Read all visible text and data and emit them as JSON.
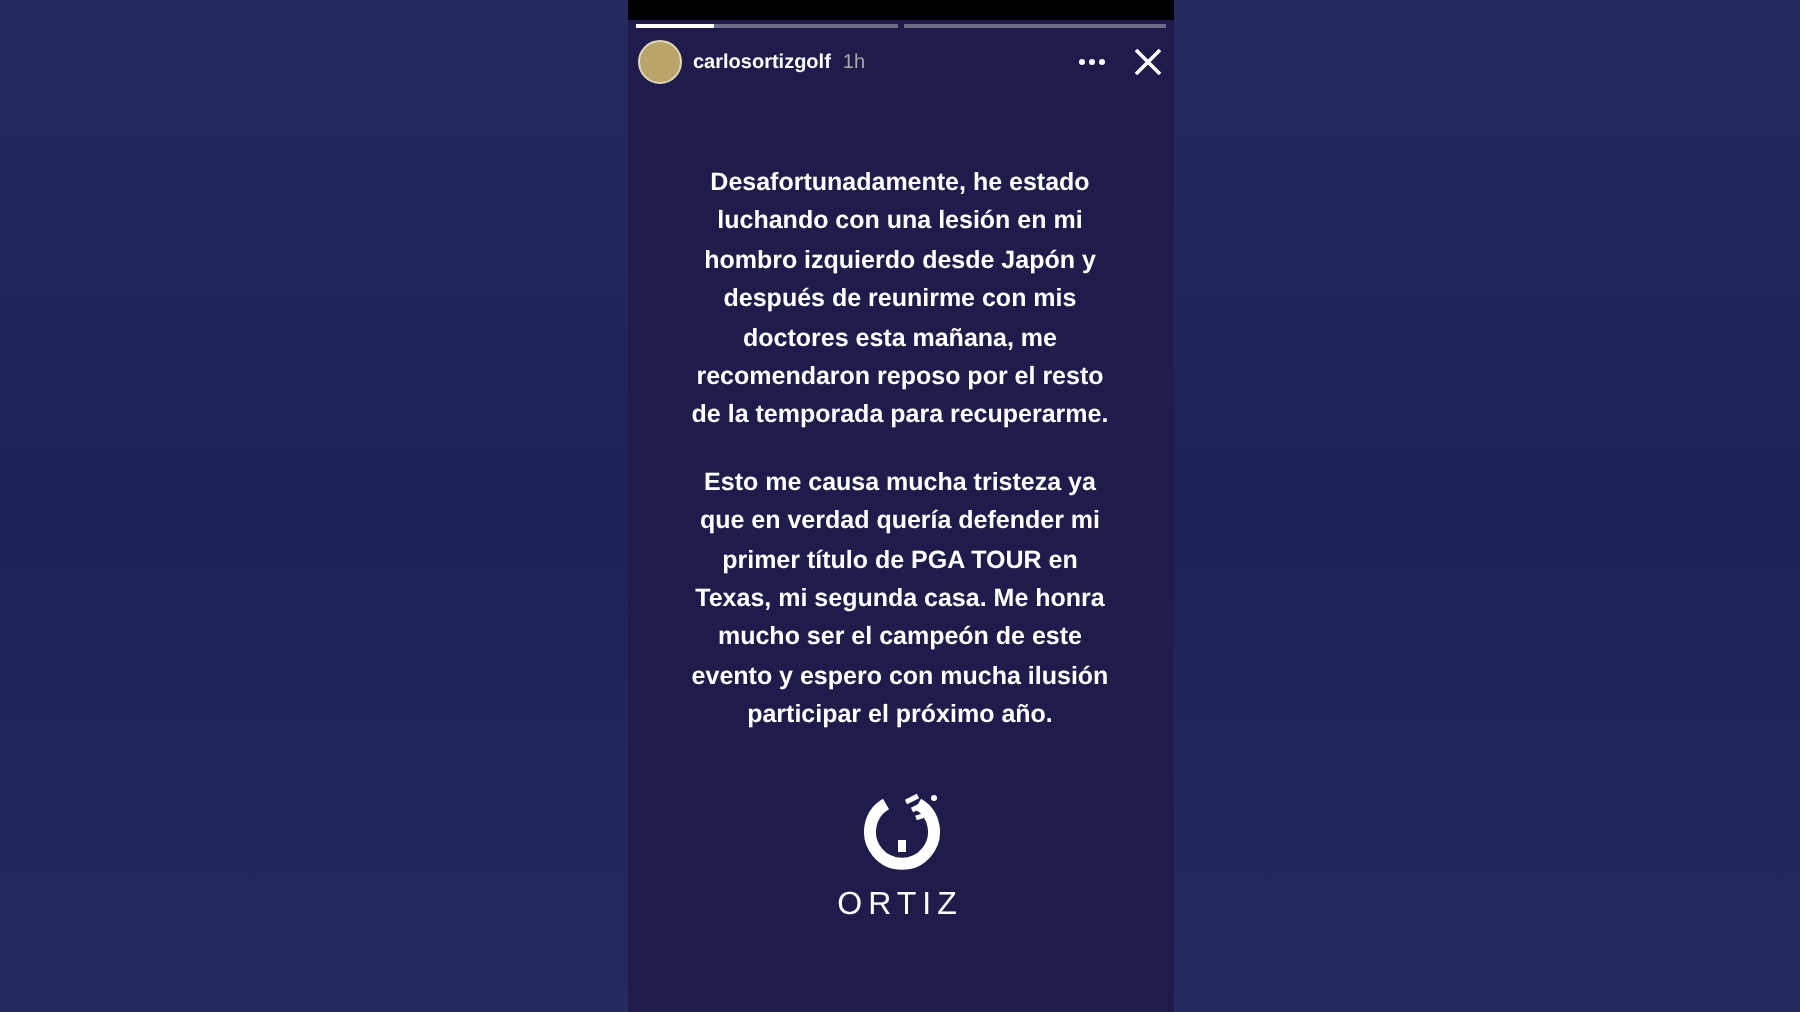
{
  "story": {
    "progress": [
      {
        "kind": "current",
        "level": 0.3
      },
      {
        "kind": "upcoming"
      }
    ],
    "account": {
      "username": "carlosortizgolf",
      "time": "1h"
    },
    "paragraphs": [
      "Desafortunadamente, he estado luchando con una lesión en mi hombro izquierdo desde Japón y después de reunirme con mis doctores esta mañana, me recomendaron reposo por el resto de la temporada para recuperarme.",
      "Esto me causa mucha tristeza ya que en verdad quería defender mi primer título de PGA TOUR en Texas, mi segunda casa. Me honra mucho ser el campeón de este evento y espero con mucha ilusión participar el próximo año."
    ],
    "logo": {
      "wordmark": "ORTIZ"
    }
  }
}
